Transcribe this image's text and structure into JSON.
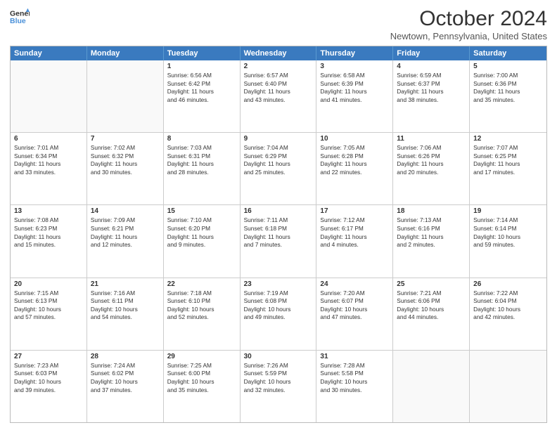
{
  "logo": {
    "line1": "General",
    "line2": "Blue"
  },
  "title": "October 2024",
  "location": "Newtown, Pennsylvania, United States",
  "days_header": [
    "Sunday",
    "Monday",
    "Tuesday",
    "Wednesday",
    "Thursday",
    "Friday",
    "Saturday"
  ],
  "rows": [
    [
      {
        "day": "",
        "lines": []
      },
      {
        "day": "",
        "lines": []
      },
      {
        "day": "1",
        "lines": [
          "Sunrise: 6:56 AM",
          "Sunset: 6:42 PM",
          "Daylight: 11 hours",
          "and 46 minutes."
        ]
      },
      {
        "day": "2",
        "lines": [
          "Sunrise: 6:57 AM",
          "Sunset: 6:40 PM",
          "Daylight: 11 hours",
          "and 43 minutes."
        ]
      },
      {
        "day": "3",
        "lines": [
          "Sunrise: 6:58 AM",
          "Sunset: 6:39 PM",
          "Daylight: 11 hours",
          "and 41 minutes."
        ]
      },
      {
        "day": "4",
        "lines": [
          "Sunrise: 6:59 AM",
          "Sunset: 6:37 PM",
          "Daylight: 11 hours",
          "and 38 minutes."
        ]
      },
      {
        "day": "5",
        "lines": [
          "Sunrise: 7:00 AM",
          "Sunset: 6:36 PM",
          "Daylight: 11 hours",
          "and 35 minutes."
        ]
      }
    ],
    [
      {
        "day": "6",
        "lines": [
          "Sunrise: 7:01 AM",
          "Sunset: 6:34 PM",
          "Daylight: 11 hours",
          "and 33 minutes."
        ]
      },
      {
        "day": "7",
        "lines": [
          "Sunrise: 7:02 AM",
          "Sunset: 6:32 PM",
          "Daylight: 11 hours",
          "and 30 minutes."
        ]
      },
      {
        "day": "8",
        "lines": [
          "Sunrise: 7:03 AM",
          "Sunset: 6:31 PM",
          "Daylight: 11 hours",
          "and 28 minutes."
        ]
      },
      {
        "day": "9",
        "lines": [
          "Sunrise: 7:04 AM",
          "Sunset: 6:29 PM",
          "Daylight: 11 hours",
          "and 25 minutes."
        ]
      },
      {
        "day": "10",
        "lines": [
          "Sunrise: 7:05 AM",
          "Sunset: 6:28 PM",
          "Daylight: 11 hours",
          "and 22 minutes."
        ]
      },
      {
        "day": "11",
        "lines": [
          "Sunrise: 7:06 AM",
          "Sunset: 6:26 PM",
          "Daylight: 11 hours",
          "and 20 minutes."
        ]
      },
      {
        "day": "12",
        "lines": [
          "Sunrise: 7:07 AM",
          "Sunset: 6:25 PM",
          "Daylight: 11 hours",
          "and 17 minutes."
        ]
      }
    ],
    [
      {
        "day": "13",
        "lines": [
          "Sunrise: 7:08 AM",
          "Sunset: 6:23 PM",
          "Daylight: 11 hours",
          "and 15 minutes."
        ]
      },
      {
        "day": "14",
        "lines": [
          "Sunrise: 7:09 AM",
          "Sunset: 6:21 PM",
          "Daylight: 11 hours",
          "and 12 minutes."
        ]
      },
      {
        "day": "15",
        "lines": [
          "Sunrise: 7:10 AM",
          "Sunset: 6:20 PM",
          "Daylight: 11 hours",
          "and 9 minutes."
        ]
      },
      {
        "day": "16",
        "lines": [
          "Sunrise: 7:11 AM",
          "Sunset: 6:18 PM",
          "Daylight: 11 hours",
          "and 7 minutes."
        ]
      },
      {
        "day": "17",
        "lines": [
          "Sunrise: 7:12 AM",
          "Sunset: 6:17 PM",
          "Daylight: 11 hours",
          "and 4 minutes."
        ]
      },
      {
        "day": "18",
        "lines": [
          "Sunrise: 7:13 AM",
          "Sunset: 6:16 PM",
          "Daylight: 11 hours",
          "and 2 minutes."
        ]
      },
      {
        "day": "19",
        "lines": [
          "Sunrise: 7:14 AM",
          "Sunset: 6:14 PM",
          "Daylight: 10 hours",
          "and 59 minutes."
        ]
      }
    ],
    [
      {
        "day": "20",
        "lines": [
          "Sunrise: 7:15 AM",
          "Sunset: 6:13 PM",
          "Daylight: 10 hours",
          "and 57 minutes."
        ]
      },
      {
        "day": "21",
        "lines": [
          "Sunrise: 7:16 AM",
          "Sunset: 6:11 PM",
          "Daylight: 10 hours",
          "and 54 minutes."
        ]
      },
      {
        "day": "22",
        "lines": [
          "Sunrise: 7:18 AM",
          "Sunset: 6:10 PM",
          "Daylight: 10 hours",
          "and 52 minutes."
        ]
      },
      {
        "day": "23",
        "lines": [
          "Sunrise: 7:19 AM",
          "Sunset: 6:08 PM",
          "Daylight: 10 hours",
          "and 49 minutes."
        ]
      },
      {
        "day": "24",
        "lines": [
          "Sunrise: 7:20 AM",
          "Sunset: 6:07 PM",
          "Daylight: 10 hours",
          "and 47 minutes."
        ]
      },
      {
        "day": "25",
        "lines": [
          "Sunrise: 7:21 AM",
          "Sunset: 6:06 PM",
          "Daylight: 10 hours",
          "and 44 minutes."
        ]
      },
      {
        "day": "26",
        "lines": [
          "Sunrise: 7:22 AM",
          "Sunset: 6:04 PM",
          "Daylight: 10 hours",
          "and 42 minutes."
        ]
      }
    ],
    [
      {
        "day": "27",
        "lines": [
          "Sunrise: 7:23 AM",
          "Sunset: 6:03 PM",
          "Daylight: 10 hours",
          "and 39 minutes."
        ]
      },
      {
        "day": "28",
        "lines": [
          "Sunrise: 7:24 AM",
          "Sunset: 6:02 PM",
          "Daylight: 10 hours",
          "and 37 minutes."
        ]
      },
      {
        "day": "29",
        "lines": [
          "Sunrise: 7:25 AM",
          "Sunset: 6:00 PM",
          "Daylight: 10 hours",
          "and 35 minutes."
        ]
      },
      {
        "day": "30",
        "lines": [
          "Sunrise: 7:26 AM",
          "Sunset: 5:59 PM",
          "Daylight: 10 hours",
          "and 32 minutes."
        ]
      },
      {
        "day": "31",
        "lines": [
          "Sunrise: 7:28 AM",
          "Sunset: 5:58 PM",
          "Daylight: 10 hours",
          "and 30 minutes."
        ]
      },
      {
        "day": "",
        "lines": []
      },
      {
        "day": "",
        "lines": []
      }
    ]
  ]
}
